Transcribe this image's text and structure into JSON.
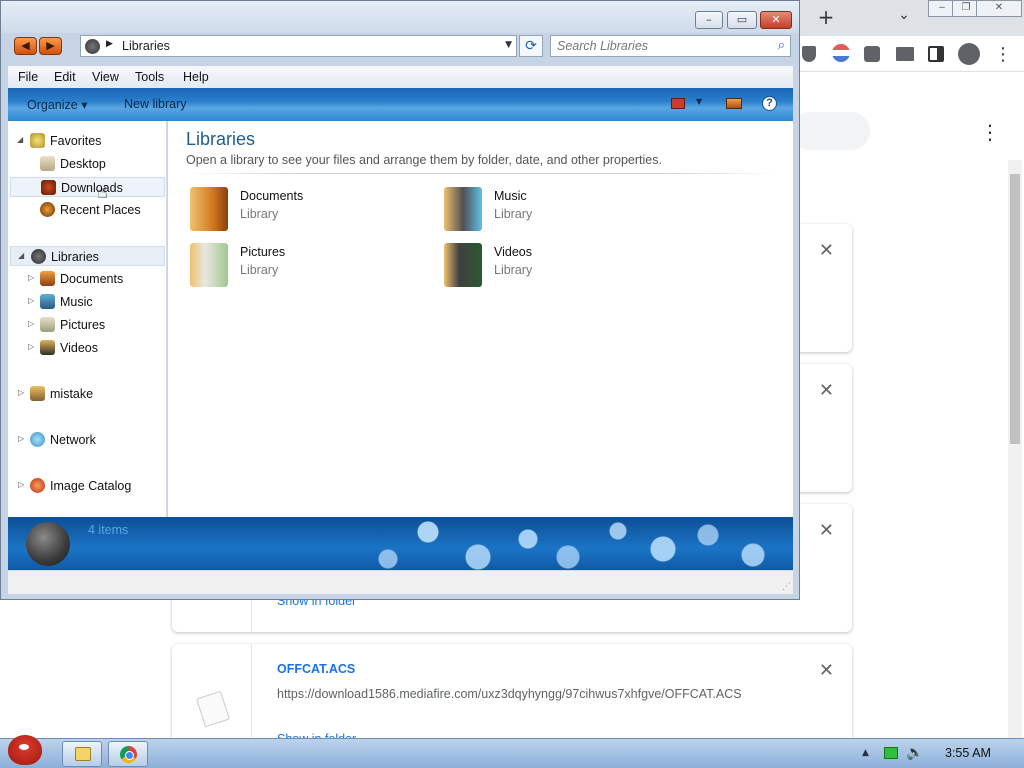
{
  "chrome": {
    "new_tab_glyph": "+",
    "tab_search_glyph": "⌄",
    "menu_glyph": "⋮",
    "downloads": [
      {
        "name": "",
        "url": "",
        "show_label": "Show in folder"
      },
      {
        "name": "OFFCAT.ACS",
        "url": "https://download1586.mediafire.com/uxz3dqyhyngg/97cihwus7xhfgve/OFFCAT.ACS",
        "show_label": "Show in folder"
      }
    ]
  },
  "explorer": {
    "address": {
      "location": "Libraries"
    },
    "search": {
      "placeholder": "Search Libraries"
    },
    "menu": [
      "File",
      "Edit",
      "View",
      "Tools",
      "Help"
    ],
    "commands": {
      "organize": "Organize ▾",
      "new_library": "New library"
    },
    "nav": {
      "favorites": "Favorites",
      "desktop": "Desktop",
      "downloads": "Downloads",
      "recent": "Recent Places",
      "libraries": "Libraries",
      "lib_documents": "Documents",
      "lib_music": "Music",
      "lib_pictures": "Pictures",
      "lib_videos": "Videos",
      "mistake": "mistake",
      "network": "Network",
      "image_catalog": "Image Catalog"
    },
    "content": {
      "title": "Libraries",
      "subtitle": "Open a library to see your files and arrange them by folder, date, and other properties.",
      "items": [
        {
          "name": "Documents",
          "type": "Library"
        },
        {
          "name": "Music",
          "type": "Library"
        },
        {
          "name": "Pictures",
          "type": "Library"
        },
        {
          "name": "Videos",
          "type": "Library"
        }
      ]
    },
    "details": {
      "count": "4 items"
    }
  },
  "taskbar": {
    "clock": "3:55 AM"
  },
  "colors": {
    "accent_blue": "#1a73e8",
    "title_green_blue": "#1e5e8c",
    "cmdbar_blue": "#2a7fcc"
  }
}
